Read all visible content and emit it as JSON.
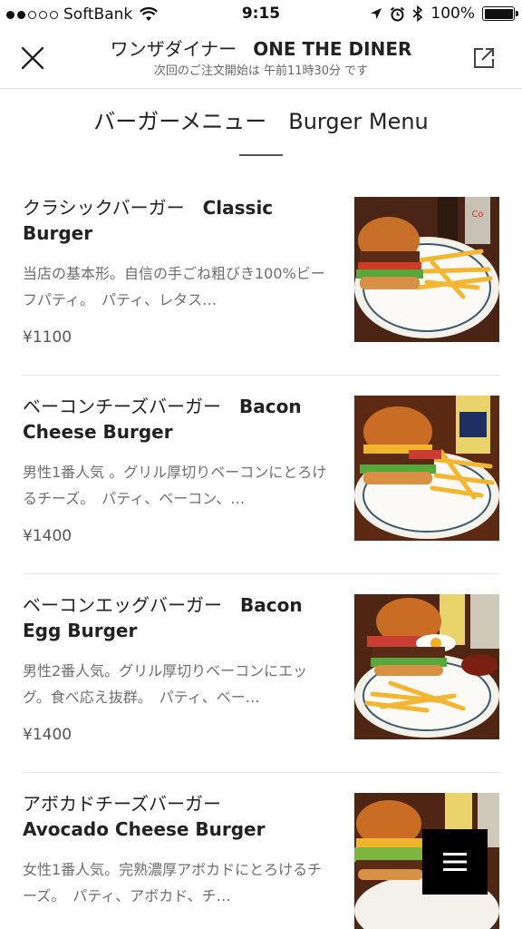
{
  "status_bar": {
    "carrier": "SoftBank",
    "time": "9:15",
    "battery": "100%",
    "battery_level": 1.0
  },
  "header": {
    "store_name_ja": "ワンザダイナー",
    "store_name_en": "ONE THE DINER",
    "order_note": "次回のご注文開始は 午前11時30分 です",
    "close_icon": "close-icon",
    "share_icon": "external-link-icon"
  },
  "section": {
    "title": "バーガーメニュー　Burger Menu"
  },
  "items": [
    {
      "name_ja": "クラシックバーガー　",
      "name_en": "Classic Burger",
      "desc": "当店の基本形。自信の手ごね粗びき100%ビーフパティ。　パティ、レタス…",
      "price": "¥1100"
    },
    {
      "name_ja": "ベーコンチーズバーガー　",
      "name_en": "Bacon Cheese Burger",
      "desc": "男性1番人気 。グリル厚切りベーコンにとろけるチーズ。　パティ、ベーコン、…",
      "price": "¥1400"
    },
    {
      "name_ja": "ベーコンエッグバーガー　",
      "name_en": "Bacon Egg Burger",
      "desc": "男性2番人気。グリル厚切りベーコンにエッグ。食べ応え抜群。　パティ、ベー…",
      "price": "¥1400"
    },
    {
      "name_ja": "アボカドチーズバーガー",
      "name_en": "Avocado Cheese Burger",
      "desc": "女性1番人気。完熟濃厚アボカドにとろけるチーズ。　パティ、アボカド、チ…",
      "price": ""
    }
  ],
  "fab": {
    "icon": "hamburger-menu-icon"
  }
}
